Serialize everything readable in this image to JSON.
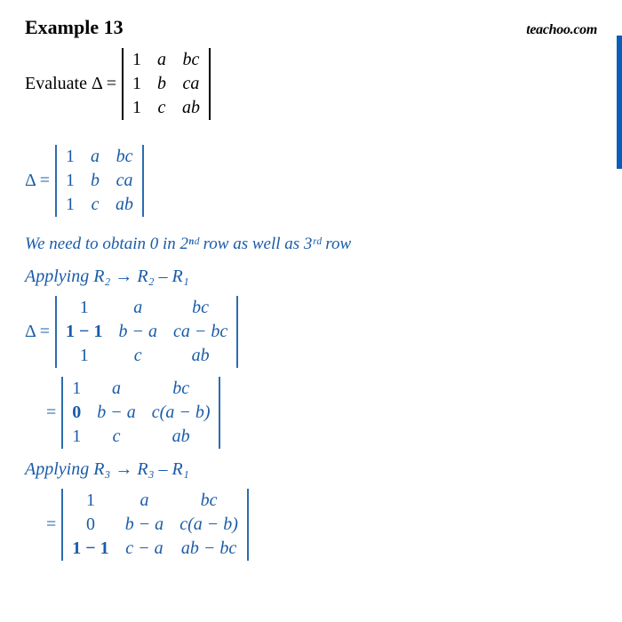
{
  "header": {
    "title": "Example 13",
    "brand": "teachoo.com"
  },
  "problem": {
    "label": "Evaluate Δ =",
    "matrix": [
      [
        "1",
        "a",
        "bc"
      ],
      [
        "1",
        "b",
        "ca"
      ],
      [
        "1",
        "c",
        "ab"
      ]
    ]
  },
  "step1": {
    "label": "Δ =",
    "matrix": [
      [
        "1",
        "a",
        "bc"
      ],
      [
        "1",
        "b",
        "ca"
      ],
      [
        "1",
        "c",
        "ab"
      ]
    ]
  },
  "note": "We need to obtain 0 in 2ⁿᵈ row as well as 3ʳᵈ  row",
  "apply1": "Applying R₂ → R₂ – R₁",
  "step2": {
    "label": "Δ =",
    "matrix": [
      [
        "1",
        "a",
        "bc"
      ],
      [
        "1 − 1",
        "b − a",
        "ca − bc"
      ],
      [
        "1",
        "c",
        "ab"
      ]
    ]
  },
  "step3": {
    "label": "=",
    "matrix": [
      [
        "1",
        "a",
        "bc"
      ],
      [
        "0",
        "b − a",
        "c(a − b)"
      ],
      [
        "1",
        "c",
        "ab"
      ]
    ]
  },
  "apply2": "Applying R₃ → R₃ – R₁",
  "step4": {
    "label": "=",
    "matrix": [
      [
        "1",
        "a",
        "bc"
      ],
      [
        "0",
        "b − a",
        "c(a − b)"
      ],
      [
        "1 − 1",
        "c − a",
        "ab − bc"
      ]
    ]
  }
}
